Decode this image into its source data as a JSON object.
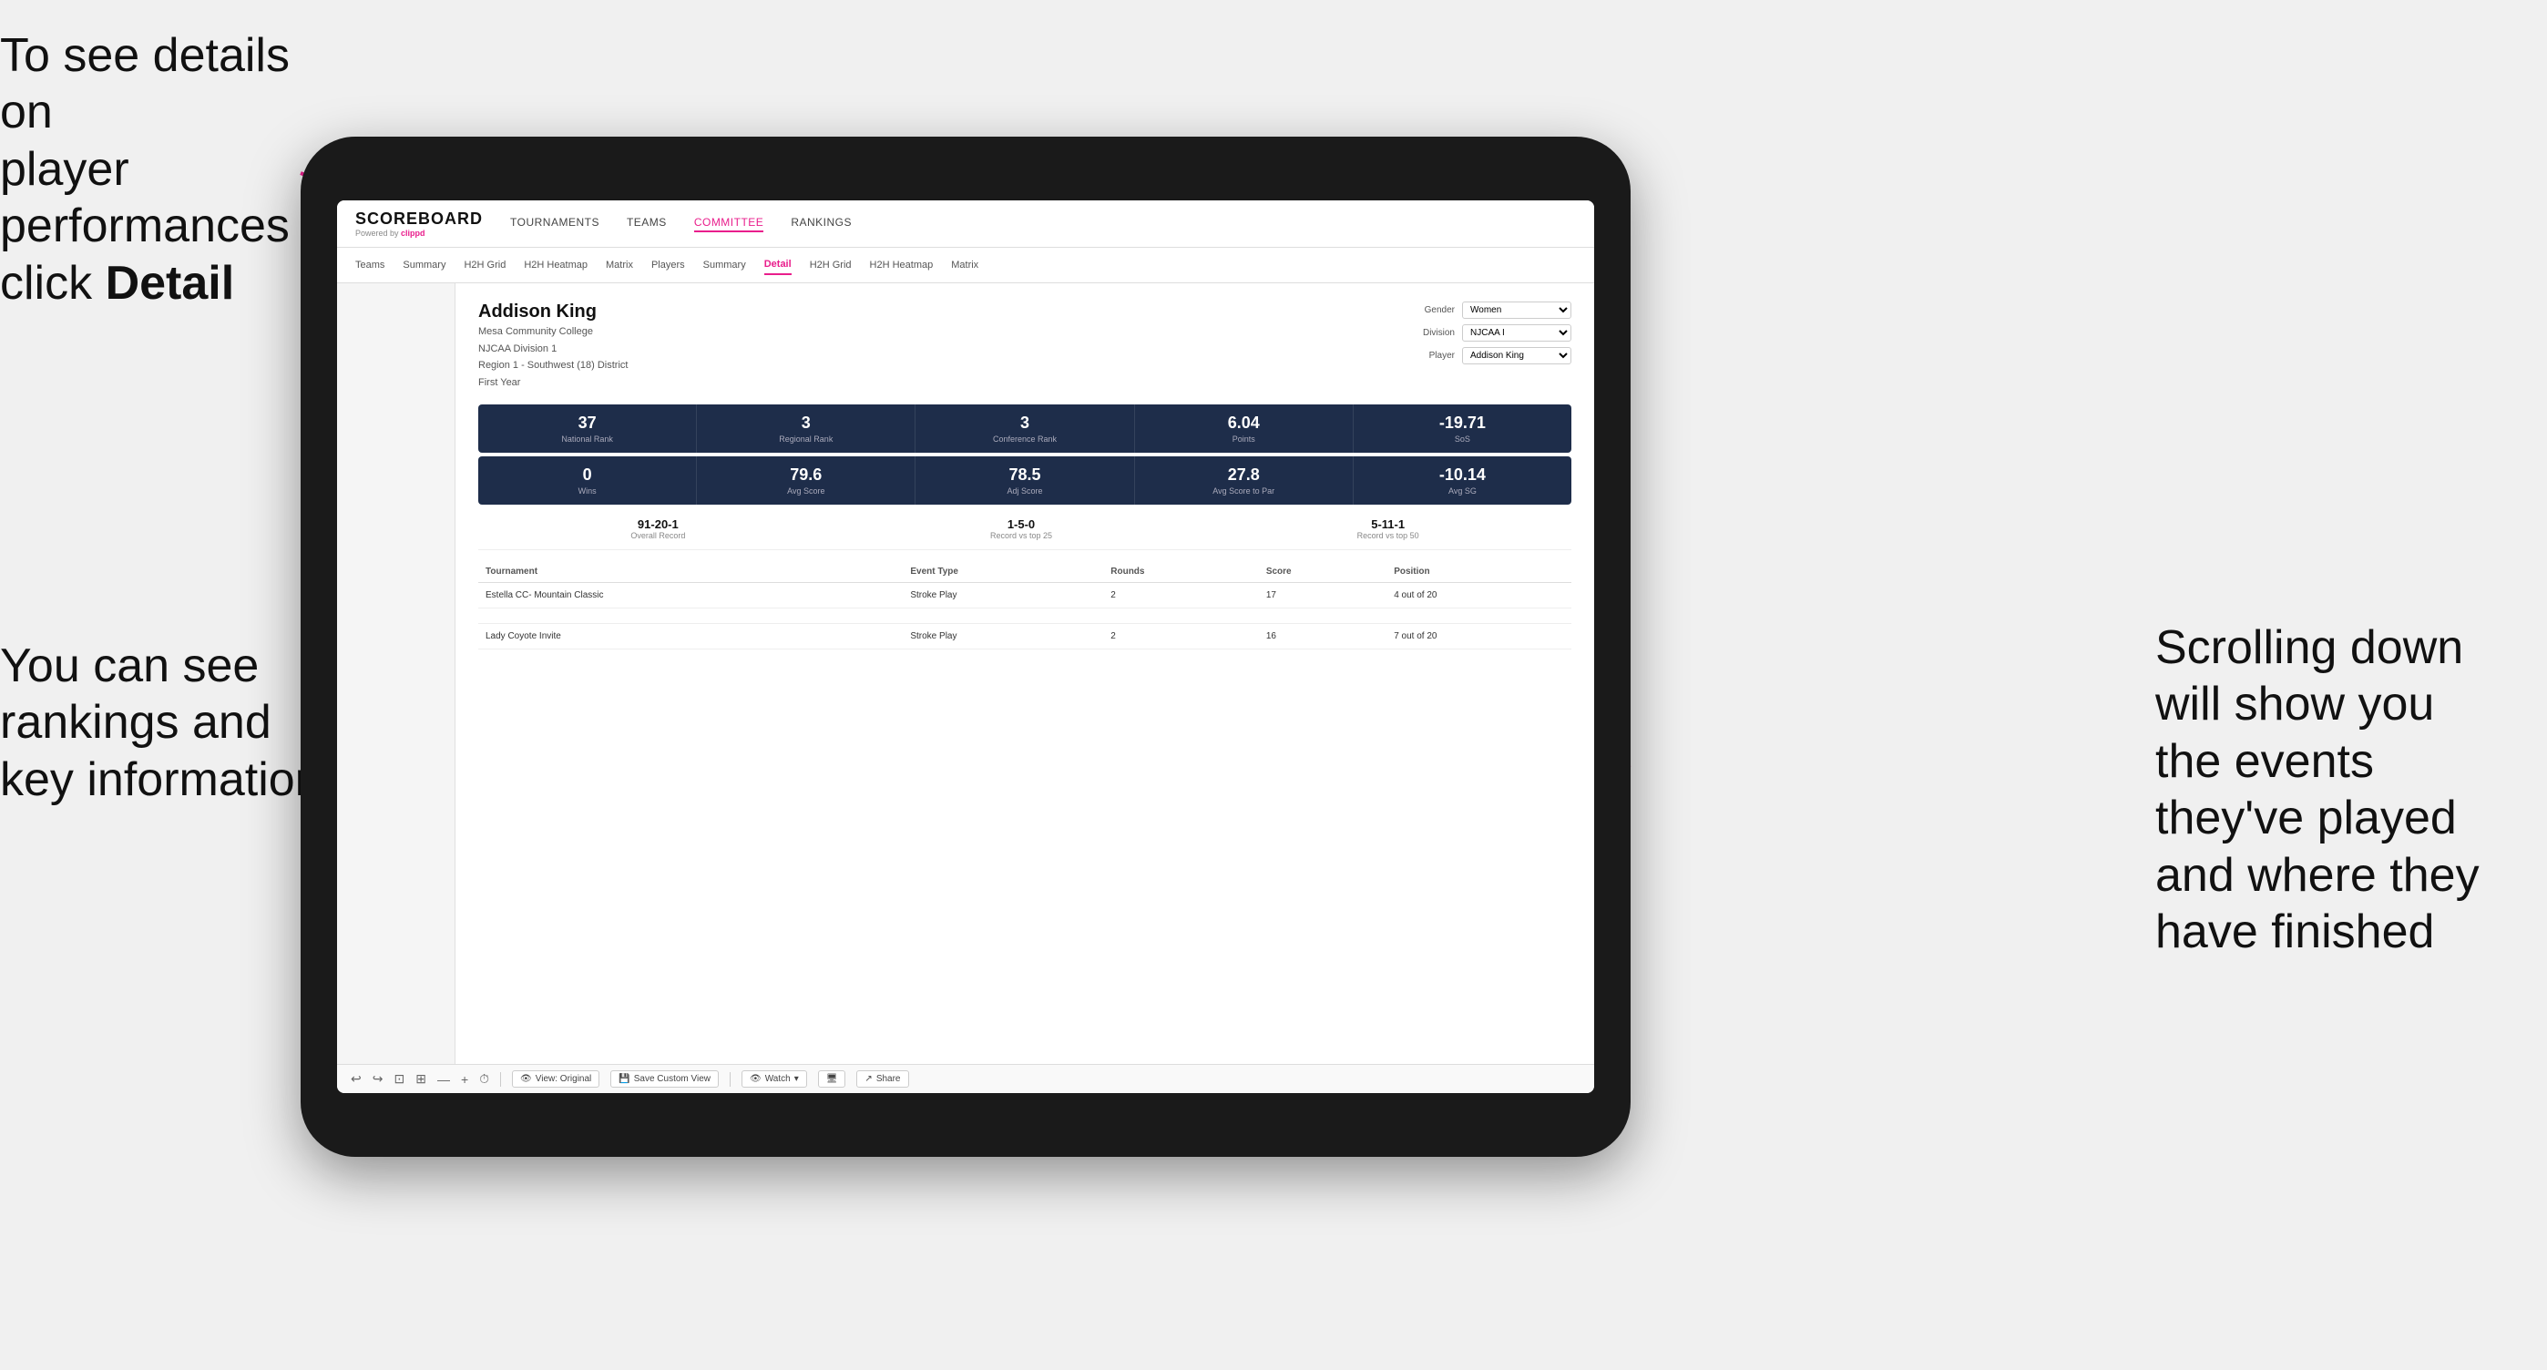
{
  "annotations": {
    "top_left_line1": "To see details on",
    "top_left_line2": "player performances",
    "top_left_line3": "click ",
    "top_left_bold": "Detail",
    "bottom_left_line1": "You can see",
    "bottom_left_line2": "rankings and",
    "bottom_left_line3": "key information",
    "right_line1": "Scrolling down",
    "right_line2": "will show you",
    "right_line3": "the events",
    "right_line4": "they've played",
    "right_line5": "and where they",
    "right_line6": "have finished"
  },
  "nav": {
    "logo": "SCOREBOARD",
    "powered_by": "Powered by",
    "clippd": "clippd",
    "items": [
      "TOURNAMENTS",
      "TEAMS",
      "COMMITTEE",
      "RANKINGS"
    ]
  },
  "sub_nav": {
    "items": [
      "Teams",
      "Summary",
      "H2H Grid",
      "H2H Heatmap",
      "Matrix",
      "Players",
      "Summary",
      "Detail",
      "H2H Grid",
      "H2H Heatmap",
      "Matrix"
    ],
    "active": "Detail"
  },
  "player": {
    "name": "Addison King",
    "college": "Mesa Community College",
    "division": "NJCAA Division 1",
    "region": "Region 1 - Southwest (18) District",
    "year": "First Year"
  },
  "controls": {
    "gender_label": "Gender",
    "gender_value": "Women",
    "division_label": "Division",
    "division_value": "NJCAA I",
    "player_label": "Player",
    "player_value": "Addison King"
  },
  "stats_row1": [
    {
      "value": "37",
      "label": "National Rank"
    },
    {
      "value": "3",
      "label": "Regional Rank"
    },
    {
      "value": "3",
      "label": "Conference Rank"
    },
    {
      "value": "6.04",
      "label": "Points"
    },
    {
      "value": "-19.71",
      "label": "SoS"
    }
  ],
  "stats_row2": [
    {
      "value": "0",
      "label": "Wins"
    },
    {
      "value": "79.6",
      "label": "Avg Score"
    },
    {
      "value": "78.5",
      "label": "Adj Score"
    },
    {
      "value": "27.8",
      "label": "Avg Score to Par"
    },
    {
      "value": "-10.14",
      "label": "Avg SG"
    }
  ],
  "records": [
    {
      "value": "91-20-1",
      "label": "Overall Record"
    },
    {
      "value": "1-5-0",
      "label": "Record vs top 25"
    },
    {
      "value": "5-11-1",
      "label": "Record vs top 50"
    }
  ],
  "table": {
    "headers": [
      "Tournament",
      "Event Type",
      "Rounds",
      "Score",
      "Position"
    ],
    "rows": [
      {
        "tournament": "Estella CC- Mountain Classic",
        "event_type": "Stroke Play",
        "rounds": "2",
        "score": "17",
        "position": "4 out of 20"
      },
      {
        "tournament": "Lady Coyote Invite",
        "event_type": "Stroke Play",
        "rounds": "2",
        "score": "16",
        "position": "7 out of 20"
      }
    ]
  },
  "toolbar": {
    "view_original": "View: Original",
    "save_custom": "Save Custom View",
    "watch": "Watch",
    "share": "Share"
  }
}
